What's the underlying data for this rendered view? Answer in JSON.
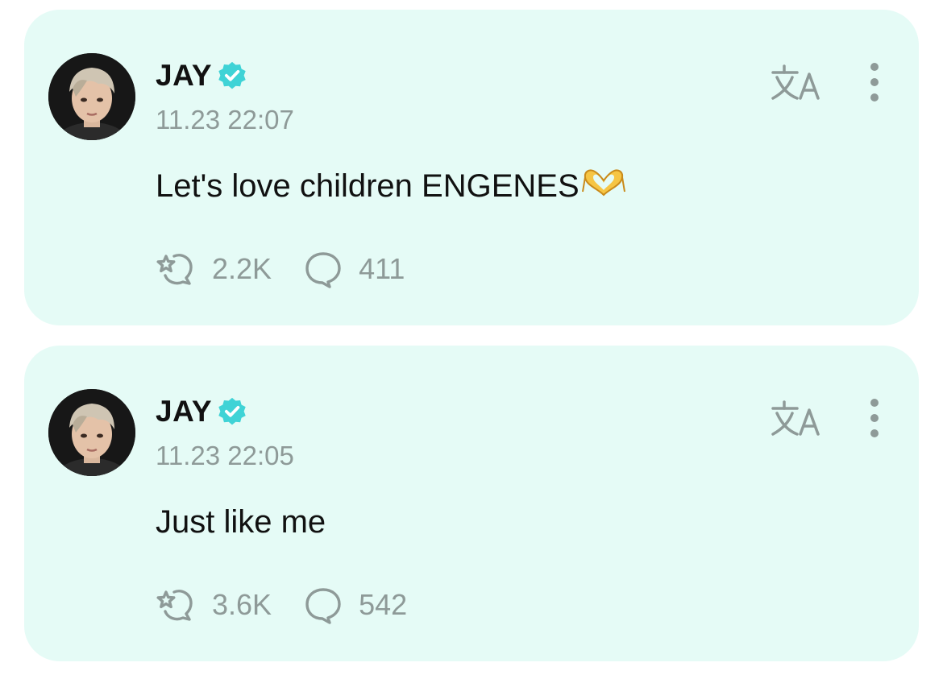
{
  "posts": [
    {
      "author": "JAY",
      "timestamp": "11.23 22:07",
      "text": "Let's love children ENGENES",
      "emoji": "heart-hands",
      "reactions": "2.2K",
      "comments": "411"
    },
    {
      "author": "JAY",
      "timestamp": "11.23 22:05",
      "text": "Just like me",
      "emoji": "",
      "reactions": "3.6K",
      "comments": "542"
    }
  ],
  "icons": {
    "verified": "verified-badge-icon",
    "translate": "translate-icon",
    "more": "more-vertical-icon",
    "reaction": "reaction-icon",
    "comment": "comment-icon"
  },
  "colors": {
    "card_bg": "#e5fbf6",
    "verified": "#3fd3d6",
    "muted": "#8e9a98",
    "text": "#111111"
  }
}
